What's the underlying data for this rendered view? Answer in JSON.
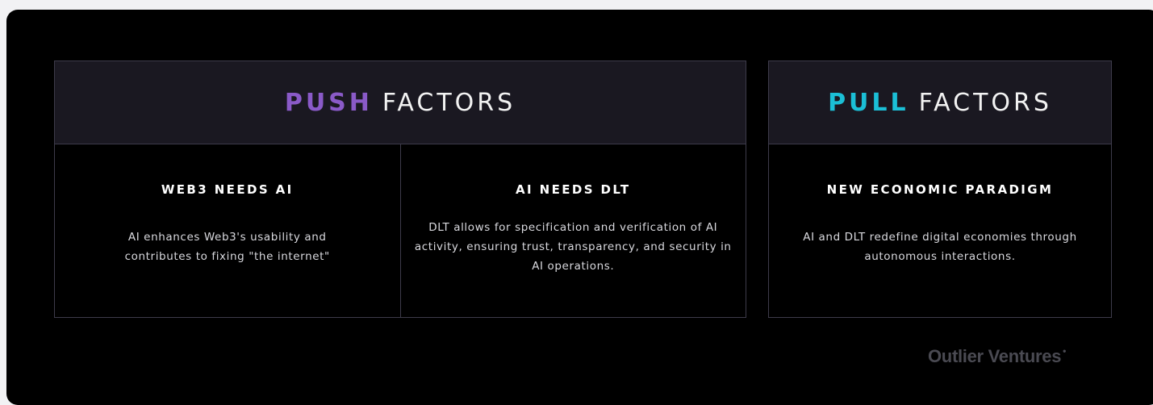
{
  "push": {
    "accent": "PUSH",
    "rest": "FACTORS",
    "accent_color": "#8a5ac8",
    "columns": [
      {
        "title": "WEB3 NEEDS AI",
        "body": "AI enhances Web3's usability and contributes to fixing \"the internet\""
      },
      {
        "title": "AI NEEDS DLT",
        "body": "DLT allows for specification and verification of AI activity, ensuring trust, transparency, and security in AI operations."
      }
    ]
  },
  "pull": {
    "accent": "PULL",
    "rest": "FACTORS",
    "accent_color": "#1bbfd6",
    "columns": [
      {
        "title": "NEW ECONOMIC PARADIGM",
        "body": "AI and DLT redefine digital economies through autonomous interactions."
      }
    ]
  },
  "brand": {
    "name": "Outlier Ventures",
    "mark": "•"
  }
}
